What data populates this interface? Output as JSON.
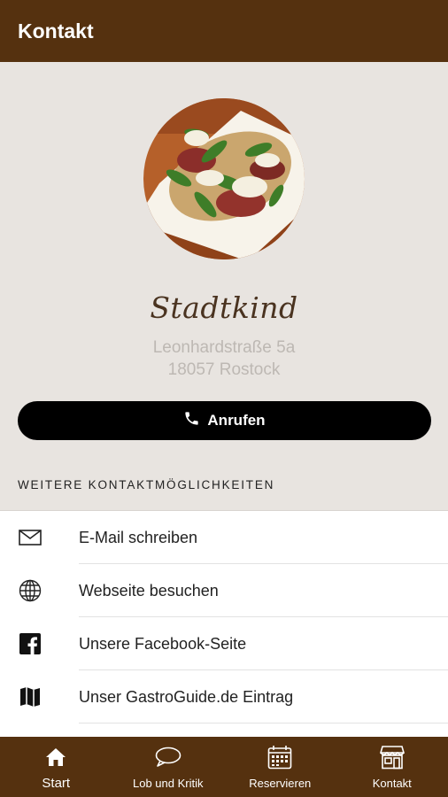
{
  "appbar": {
    "title": "Kontakt"
  },
  "restaurant": {
    "name": "Stadtkind",
    "address_line1": "Leonhardstraße 5a",
    "address_line2": "18057 Rostock"
  },
  "call_button": {
    "label": "Anrufen",
    "icon": "phone-icon"
  },
  "section_title": "WEITERE KONTAKTMÖGLICHKEITEN",
  "contact_options": [
    {
      "label": "E-Mail schreiben",
      "icon": "mail-icon"
    },
    {
      "label": "Webseite besuchen",
      "icon": "globe-icon"
    },
    {
      "label": "Unsere Facebook-Seite",
      "icon": "facebook-icon"
    },
    {
      "label": "Unser GastroGuide.de Eintrag",
      "icon": "map-icon"
    }
  ],
  "tabs": [
    {
      "label": "Start",
      "icon": "home-icon",
      "active": true
    },
    {
      "label": "Lob und Kritik",
      "icon": "speech-bubble-icon",
      "active": false
    },
    {
      "label": "Reservieren",
      "icon": "calendar-icon",
      "active": false
    },
    {
      "label": "Kontakt",
      "icon": "storefront-icon",
      "active": false
    }
  ],
  "colors": {
    "brand": "#55310f",
    "background": "#e8e4e0",
    "button": "#000000"
  }
}
